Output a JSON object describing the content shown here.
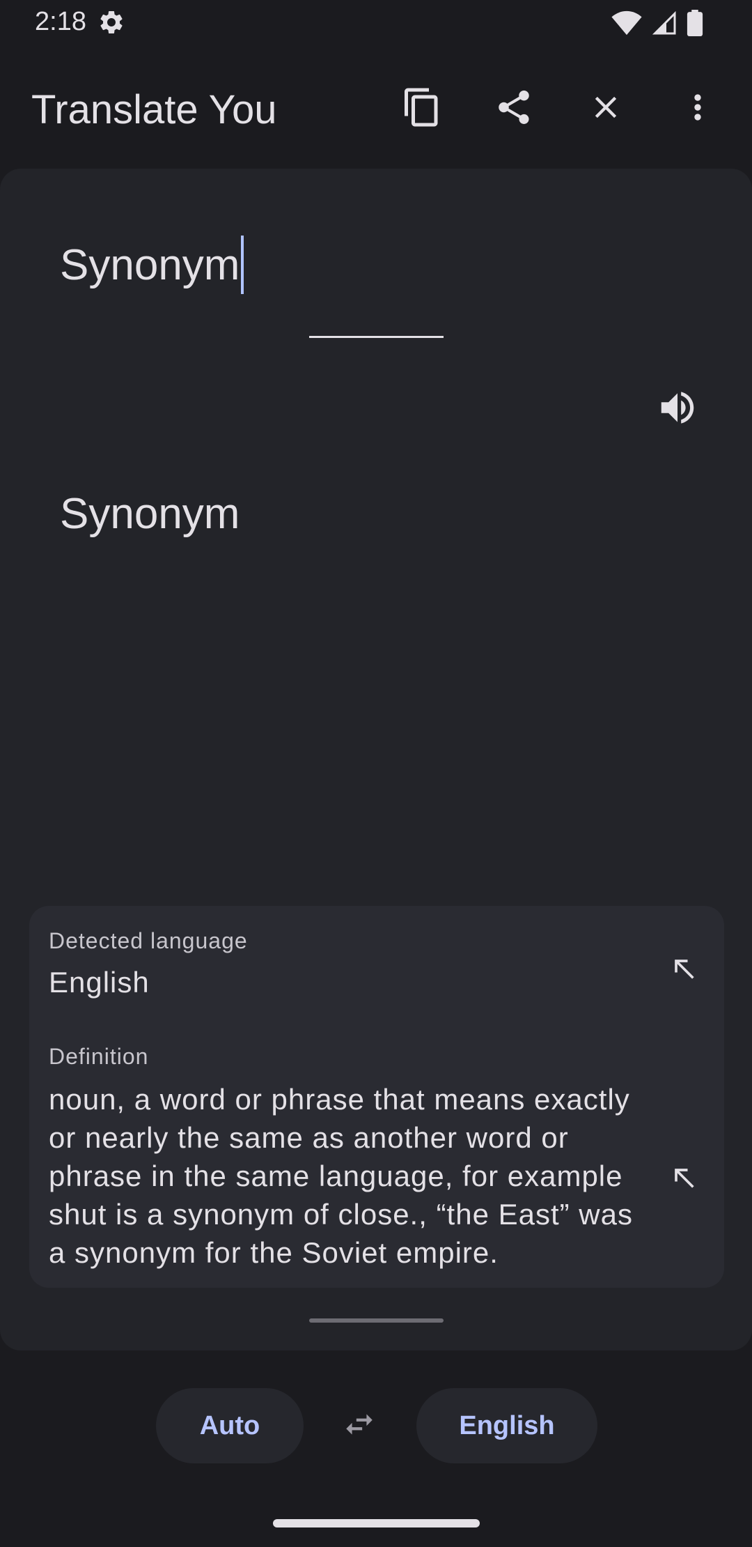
{
  "status_bar": {
    "time": "2:18",
    "icons": [
      "settings-gear-icon",
      "wifi-icon",
      "cell-signal-icon",
      "battery-icon"
    ]
  },
  "app_bar": {
    "title": "Translate You",
    "actions": [
      "copy-icon",
      "share-icon",
      "close-icon",
      "more-vert-icon"
    ]
  },
  "source": {
    "text": "Synonym"
  },
  "translation": {
    "text": "Synonym"
  },
  "info": {
    "detected_label": "Detected language",
    "detected_value": "English",
    "definition_label": "Definition",
    "definition_text": "noun, a word or phrase that means exactly or nearly the same as another word or phrase in the same language, for example shut is a synonym of close., “the East” was a synonym for the Soviet empire."
  },
  "languages": {
    "source": "Auto",
    "target": "English"
  },
  "colors": {
    "background": "#1b1b1f",
    "card": "#232429",
    "info_card": "#2a2b32",
    "accent": "#b6c4ff"
  }
}
